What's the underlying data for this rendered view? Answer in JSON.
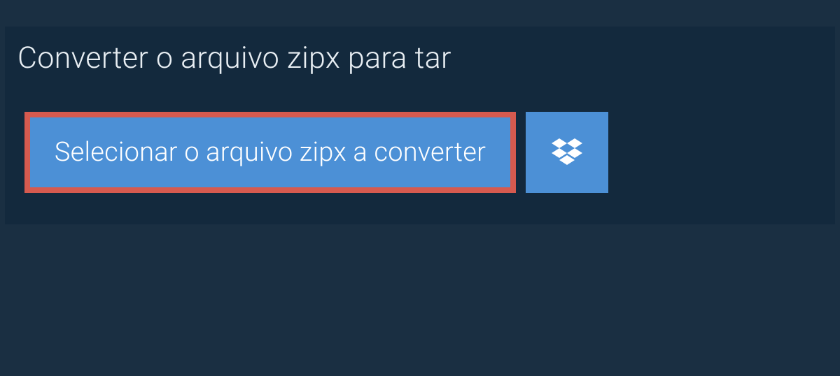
{
  "title": "Converter o arquivo zipx para tar",
  "select_button_label": "Selecionar o arquivo zipx a converter"
}
